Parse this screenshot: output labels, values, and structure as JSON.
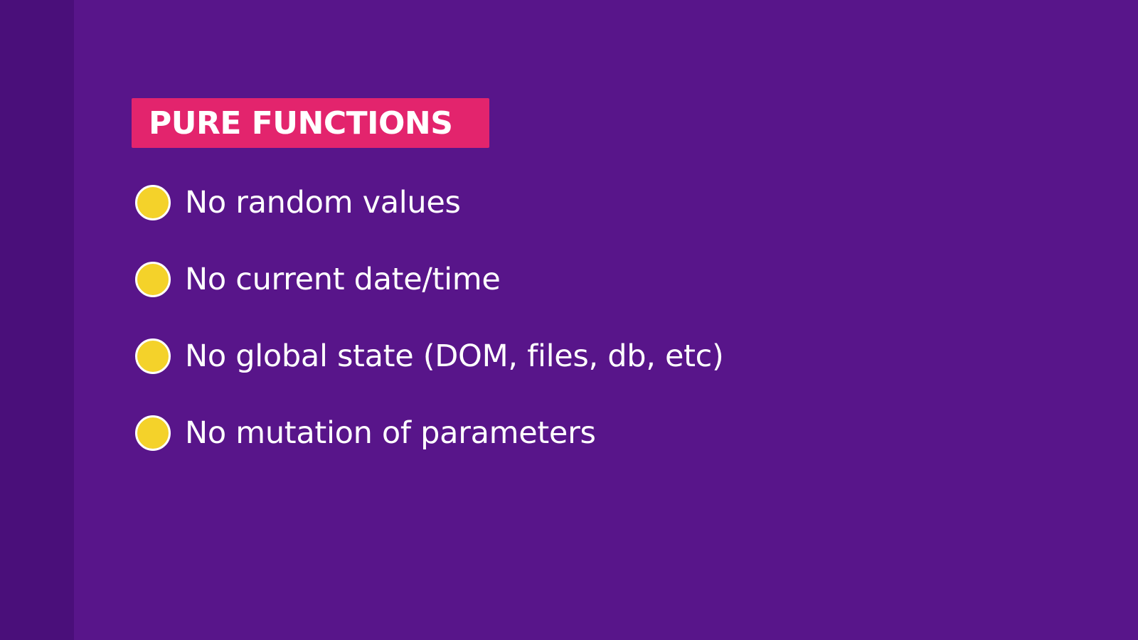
{
  "slide": {
    "title": "PURE FUNCTIONS",
    "bullets": [
      {
        "text": "No random values",
        "icon": "bullet-dot-icon"
      },
      {
        "text": "No current date/time",
        "icon": "bullet-dot-icon"
      },
      {
        "text": "No global state (DOM, files, db, etc)",
        "icon": "bullet-dot-icon"
      },
      {
        "text": "No mutation of parameters",
        "icon": "bullet-dot-icon"
      }
    ]
  },
  "colors": {
    "background": "#58158a",
    "side_strip": "#4a0f7a",
    "title_badge": "#e3246d",
    "bullet_fill": "#f4d22a",
    "bullet_border": "#ffffff",
    "text": "#ffffff"
  }
}
